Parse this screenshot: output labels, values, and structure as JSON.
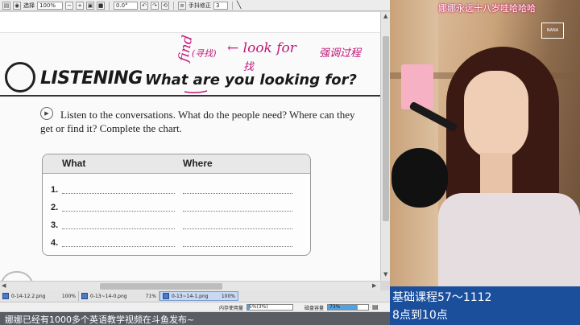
{
  "toolbar": {
    "select_label": "选择",
    "zoom_value": "100%",
    "rotation_value": "0.0°",
    "hand_tool_label": "手抖修正",
    "hand_tool_value": "3"
  },
  "document": {
    "section_title": "LISTENING",
    "question": "What are you looking for?",
    "annotation_left": "find",
    "annotation_paren": "(寻找)",
    "annotation_right": "← look for",
    "annotation_cn": "强调过程",
    "annotation_under": "找",
    "instructions": "Listen to the conversations. What do the people need? Where can they get or find it? Complete the chart.",
    "chart": {
      "headers": [
        "What",
        "Where"
      ],
      "rows": [
        "1.",
        "2.",
        "3.",
        "4."
      ]
    }
  },
  "tabs": [
    {
      "name": "0-14-12.2.png",
      "zoom": "100%"
    },
    {
      "name": "0-13~14-0.png",
      "zoom": "71%"
    },
    {
      "name": "0-13~14-1.png",
      "zoom": "100%",
      "active": true
    }
  ],
  "status": {
    "memory_label": "内存使用量",
    "memory_value": "5%(3%)",
    "memory_fraction": 0.05,
    "disk_label": "磁盘容量",
    "disk_value": "73%",
    "disk_fraction": 0.73,
    "accent": "#4da3e6"
  },
  "ticker_text": "娜娜已经有1000多个英语教学视频在斗鱼发布~",
  "webcam": {
    "title": "娜娜永远十八岁哇哈哈哈",
    "logo_text": "NANA"
  },
  "info_panel": {
    "line1": "基础课程57～1112",
    "line2": "8点到10点",
    "bg": "#1b4f9c"
  }
}
